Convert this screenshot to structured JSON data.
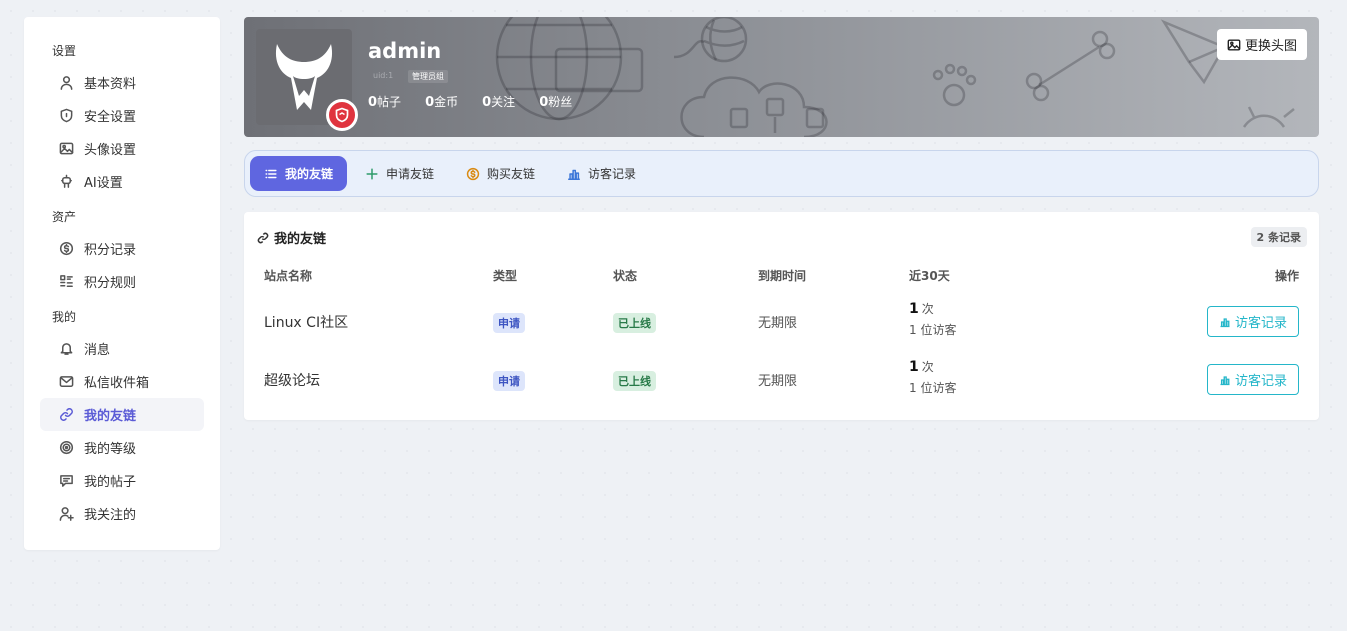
{
  "sidebar": {
    "groups": [
      {
        "title": "设置",
        "items": [
          {
            "label": "基本资料",
            "icon": "user-icon"
          },
          {
            "label": "安全设置",
            "icon": "shield-icon"
          },
          {
            "label": "头像设置",
            "icon": "image-icon"
          },
          {
            "label": "AI设置",
            "icon": "robot-icon"
          }
        ]
      },
      {
        "title": "资产",
        "items": [
          {
            "label": "积分记录",
            "icon": "coin-icon"
          },
          {
            "label": "积分规则",
            "icon": "rules-icon"
          }
        ]
      },
      {
        "title": "我的",
        "items": [
          {
            "label": "消息",
            "icon": "bell-icon"
          },
          {
            "label": "私信收件箱",
            "icon": "mail-icon"
          },
          {
            "label": "我的友链",
            "icon": "link-icon",
            "active": true
          },
          {
            "label": "我的等级",
            "icon": "level-icon"
          },
          {
            "label": "我的帖子",
            "icon": "post-icon"
          },
          {
            "label": "我关注的",
            "icon": "user-plus-icon"
          }
        ]
      }
    ]
  },
  "profile": {
    "name": "admin",
    "uid": "uid:1",
    "role": "管理员组",
    "stats": [
      {
        "value": "0",
        "label": "帖子"
      },
      {
        "value": "0",
        "label": "金币"
      },
      {
        "value": "0",
        "label": "关注"
      },
      {
        "value": "0",
        "label": "粉丝"
      }
    ],
    "change_avatar_label": "更换头图"
  },
  "tabs": [
    {
      "label": "我的友链",
      "icon": "list-icon",
      "active": true
    },
    {
      "label": "申请友链",
      "icon": "plus-icon"
    },
    {
      "label": "购买友链",
      "icon": "dollar-icon"
    },
    {
      "label": "访客记录",
      "icon": "bar-chart-icon"
    }
  ],
  "card": {
    "title": "我的友链",
    "count_badge": "2 条记录",
    "headers": [
      "站点名称",
      "类型",
      "状态",
      "到期时间",
      "近30天",
      "操作"
    ],
    "rows": [
      {
        "site": "Linux CI社区",
        "type": "申请",
        "status": "已上线",
        "expire": "无期限",
        "visits": "1",
        "visits_unit": "次",
        "visitors": "1 位访客",
        "action": "访客记录"
      },
      {
        "site": "超级论坛",
        "type": "申请",
        "status": "已上线",
        "expire": "无期限",
        "visits": "1",
        "visits_unit": "次",
        "visitors": "1 位访客",
        "action": "访客记录"
      }
    ]
  },
  "colors": {
    "accent": "#5f66e0",
    "active_text": "#5b5bd6",
    "tab_bar_bg": "#e9f0fb",
    "action_cyan": "#24b6c9",
    "badge_red": "#e0343f"
  }
}
